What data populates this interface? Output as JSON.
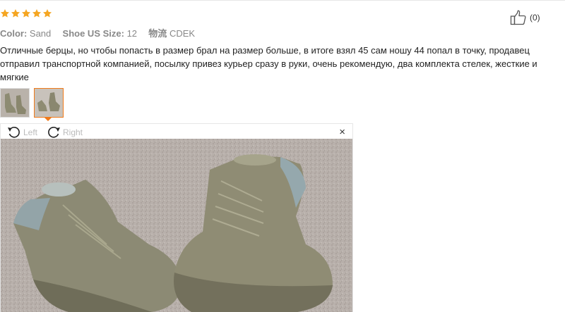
{
  "rating": {
    "stars": 5,
    "color": "#f5a623"
  },
  "like": {
    "icon": "thumbs-up-icon",
    "count_text": "(0)"
  },
  "meta": {
    "color_label": "Color:",
    "color_value": "Sand",
    "size_label": "Shoe US Size:",
    "size_value": "12",
    "shipping_label": "物流",
    "shipping_value": "CDEK"
  },
  "review": {
    "text": "Отличные берцы, но чтобы попасть в размер брал на размер больше, в итоге взял 45 сам ношу 44 попал в точку, продавец отправил транспортной компанией, посылку привез курьер сразу в руки, очень рекомендую, два комплекта стелек, жесткие и мягкие"
  },
  "thumbnails": [
    {
      "name": "photo-thumbnail-1",
      "selected": false
    },
    {
      "name": "photo-thumbnail-2",
      "selected": true
    }
  ],
  "viewer": {
    "rotate_left_label": "Left",
    "rotate_right_label": "Right",
    "close_symbol": "×",
    "accent": "#f07a1a"
  }
}
